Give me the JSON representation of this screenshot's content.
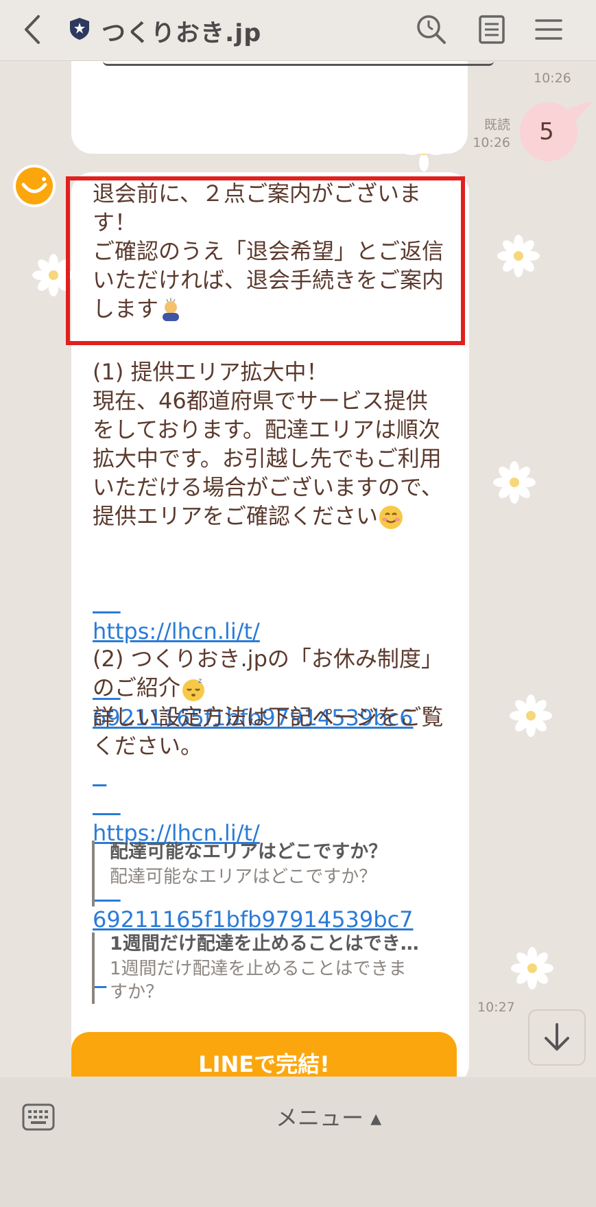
{
  "header": {
    "title": "つくりおき.jp"
  },
  "chat": {
    "prev_time": "10:26",
    "read_label": "既読",
    "read_time": "10:26",
    "user_message": "5",
    "bot_message": {
      "intro": "退会前に、２点ご案内がございます！\nご確認のうえ「退会希望」とご返信いただければ、退会手続きをご案内します",
      "section1_title": "(1) 提供エリア拡大中！",
      "section1_body": "現在、46都道府県でサービス提供をしております。配達エリアは順次拡大中です。お引越し先でもご利用いただける場合がございますので、提供エリアをご確認ください",
      "link1_line1": "https://lhcn.li/t/",
      "link1_line2": "69211165f1bfb97914539bc6",
      "section2_title": "(2) つくりおき.jpの「お休み制度」のご紹介",
      "section2_body": "詳しい設定方法は下記ページをご覧ください。",
      "link2_line1": "https://lhcn.li/t/",
      "link2_line2": "69211165f1bfb97914539bc7",
      "time": "10:27"
    },
    "quotes": [
      {
        "title": "配達可能なエリアはどこですか？",
        "body": "配達可能なエリアはどこですか？"
      },
      {
        "title": "1週間だけ配達を止めることはでき…",
        "body": "1週間だけ配達を止めることはできますか？"
      }
    ],
    "line_button": "LINEで完結!"
  },
  "footer": {
    "menu_label": "メニュー ▴"
  },
  "icons": {
    "back": "chevron-left-icon",
    "shield": "shield-star-icon",
    "search": "search-icon",
    "notes": "document-icon",
    "menu": "hamburger-menu-icon",
    "avatar": "smile-avatar-icon",
    "scroll": "arrow-down-icon",
    "keyboard": "keyboard-icon"
  },
  "colors": {
    "accent_orange": "#fca60e",
    "highlight_red": "#e0201f",
    "link_blue": "#2b7bd6",
    "user_bubble": "#f9d3d6"
  }
}
